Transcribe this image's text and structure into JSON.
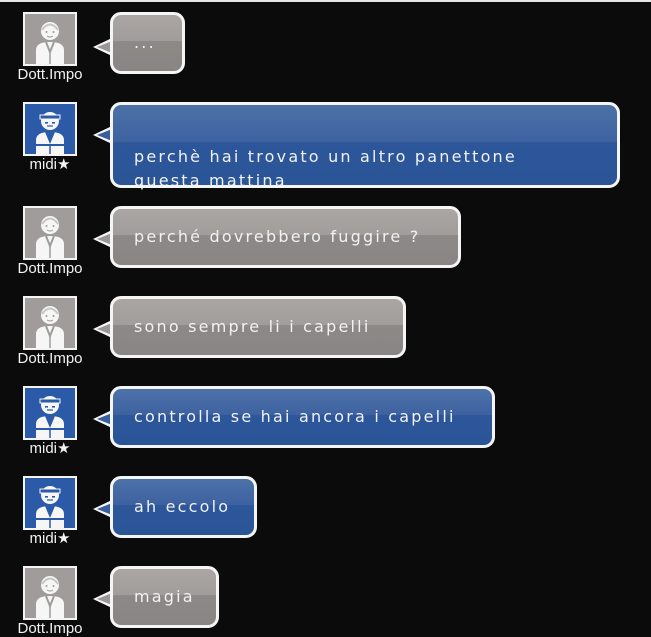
{
  "messages": [
    {
      "sender": "Dott.Impo",
      "avatar": "gray",
      "text": "..."
    },
    {
      "sender": "midi★",
      "avatar": "blue",
      "text": "perchè hai trovato un altro panettone\nquesta mattina"
    },
    {
      "sender": "Dott.Impo",
      "avatar": "gray",
      "text": "perché dovrebbero fuggire ?"
    },
    {
      "sender": "Dott.Impo",
      "avatar": "gray",
      "text": "sono sempre li i capelli"
    },
    {
      "sender": "midi★",
      "avatar": "blue",
      "text": "controlla se hai ancora i capelli"
    },
    {
      "sender": "midi★",
      "avatar": "blue",
      "text": "ah eccolo"
    },
    {
      "sender": "Dott.Impo",
      "avatar": "gray",
      "text": "magia"
    }
  ],
  "colors": {
    "background": "#0b0b0b",
    "gray_bubble": "#9b9796",
    "blue_bubble": "#2b5aa8",
    "bubble_border": "#f5f5f5"
  },
  "icons": {
    "gray": "person-avatar-icon",
    "blue": "headband-avatar-icon"
  }
}
